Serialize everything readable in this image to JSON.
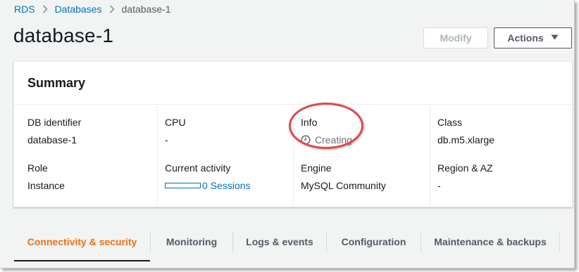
{
  "breadcrumb": {
    "items": [
      {
        "label": "RDS",
        "link": true
      },
      {
        "label": "Databases",
        "link": true
      },
      {
        "label": "database-1",
        "link": false
      }
    ]
  },
  "header": {
    "title": "database-1",
    "modify_label": "Modify",
    "actions_label": "Actions"
  },
  "summary": {
    "title": "Summary",
    "columns": [
      {
        "top": {
          "label": "DB identifier",
          "value": "database-1"
        },
        "bottom": {
          "label": "Role",
          "value": "Instance"
        }
      },
      {
        "top": {
          "label": "CPU",
          "value": "-"
        },
        "bottom": {
          "label": "Current activity",
          "value": "0 Sessions",
          "meter_fraction": 0
        }
      },
      {
        "top": {
          "label": "Info",
          "value": "Creating"
        },
        "bottom": {
          "label": "Engine",
          "value": "MySQL Community"
        }
      },
      {
        "top": {
          "label": "Class",
          "value": "db.m5.xlarge"
        },
        "bottom": {
          "label": "Region & AZ",
          "value": "-"
        }
      }
    ]
  },
  "tabs": [
    {
      "label": "Connectivity & security",
      "active": true
    },
    {
      "label": "Monitoring",
      "active": false
    },
    {
      "label": "Logs & events",
      "active": false
    },
    {
      "label": "Configuration",
      "active": false
    },
    {
      "label": "Maintenance & backups",
      "active": false
    }
  ],
  "colors": {
    "link": "#0073bb",
    "active_tab": "#ec7211",
    "highlight": "#e0474c",
    "status_pending": "#687078"
  },
  "icons": {
    "breadcrumb_separator": "chevron-right-icon",
    "actions_caret": "caret-down-icon",
    "status": "clock-icon"
  }
}
